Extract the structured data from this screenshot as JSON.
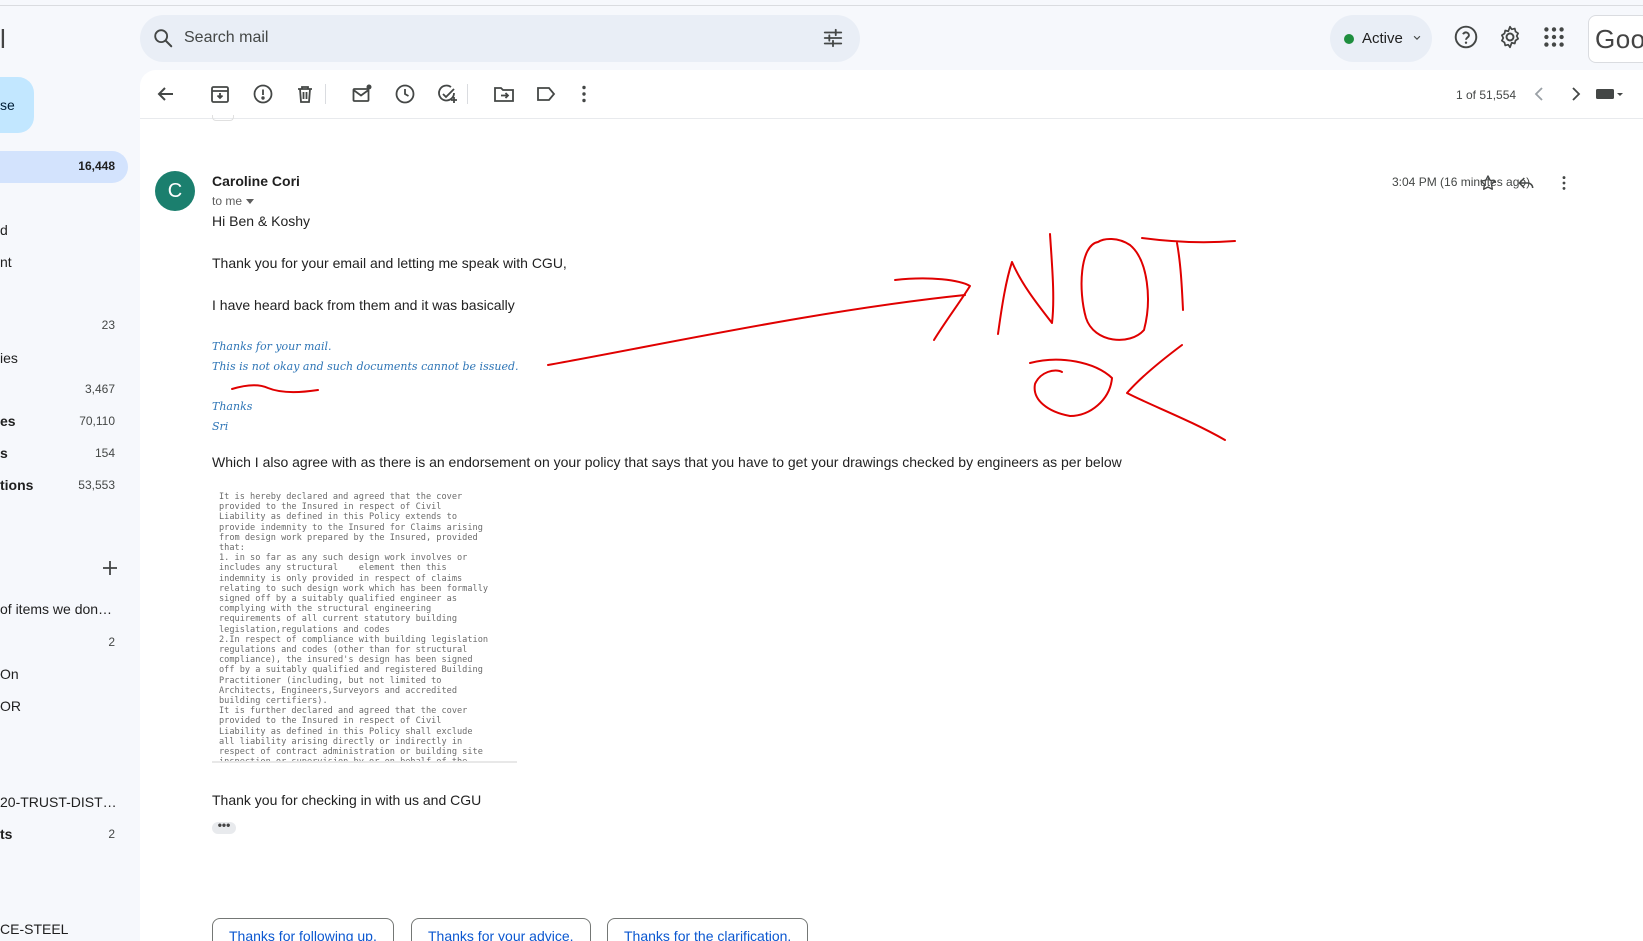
{
  "header": {
    "brand_fragment": "l",
    "search_placeholder": "Search mail",
    "status_label": "Active",
    "account_brand": "Goo"
  },
  "sidebar": {
    "compose_label": "se",
    "inbox_count": "16,448",
    "items": [
      {
        "label": "d",
        "count": "",
        "bold": false
      },
      {
        "label": "nt",
        "count": "",
        "bold": false
      },
      {
        "label": "",
        "count": "23",
        "bold": false
      },
      {
        "label": "ies",
        "count": "",
        "bold": false
      },
      {
        "label": "",
        "count": "3,467",
        "bold": false
      },
      {
        "label": "es",
        "count": "70,110",
        "bold": true
      },
      {
        "label": "s",
        "count": "154",
        "bold": true
      },
      {
        "label": "tions",
        "count": "53,553",
        "bold": true
      }
    ],
    "labels": [
      {
        "label": "of items we don…",
        "count": ""
      },
      {
        "label": "",
        "count": "2"
      },
      {
        "label": "On",
        "count": ""
      },
      {
        "label": "OR",
        "count": ""
      },
      {
        "label": "20-TRUST-DIST…",
        "count": ""
      },
      {
        "label": "ts",
        "count": "2",
        "bold": true
      },
      {
        "label": "CE-STEEL",
        "count": ""
      }
    ]
  },
  "toolbar": {
    "pager": "1 of 51,554"
  },
  "message": {
    "avatar_letter": "C",
    "sender": "Caroline Cori",
    "recipient": "to me",
    "timestamp": "3:04 PM (16 minutes ago)",
    "greeting": "Hi Ben & Koshy",
    "p1": "Thank you for your email and letting me speak with CGU,",
    "p2": "I have heard back from them and it was basically",
    "quote1": "Thanks for your mail.",
    "quote2": "This is not okay and such documents cannot be issued.",
    "quote3": "Thanks",
    "quote4": "Sri",
    "p3": "Which I also agree with as there is an endorsement on your policy that says that you have to get your drawings checked by engineers as per below",
    "policy_text": "It is hereby declared and agreed that the cover\nprovided to the Insured in respect of Civil\nLiability as defined in this Policy extends to\nprovide indemnity to the Insured for Claims arising\nfrom design work prepared by the Insured, provided\nthat:\n1. in so far as any such design work involves or\nincludes any structural    element then this\nindemnity is only provided in respect of claims\nrelating to such design work which has been formally\nsigned off by a suitably qualified engineer as\ncomplying with the structural engineering\nrequirements of all current statutory building\nlegislation,regulations and codes\n2.In respect of compliance with building legislation\nregulations and codes (other than for structural\ncompliance), the insured's design has been signed\noff by a suitably qualified and registered Building\nPractitioner (including, but not limited to\nArchitects, Engineers,Surveyors and accredited\nbuilding certifiers).\nIt is further declared and agreed that the cover\nprovided to the Insured in respect of Civil\nLiability as defined in this Policy shall exclude\nall liability arising directly or indirectly in\nrespect of contract administration or building site\ninspection or supervision by or on behalf of the\nInsured.",
    "closing": "Thank you for checking in with us and CGU",
    "ellipsis": "•••"
  },
  "smart_replies": [
    "Thanks for following up.",
    "Thanks for your advice.",
    "Thanks for the clarification."
  ],
  "colors": {
    "annotation": "#e00000",
    "quote": "#2e75b6",
    "accent": "#0b57d0",
    "avatar": "#1b7f6e"
  }
}
